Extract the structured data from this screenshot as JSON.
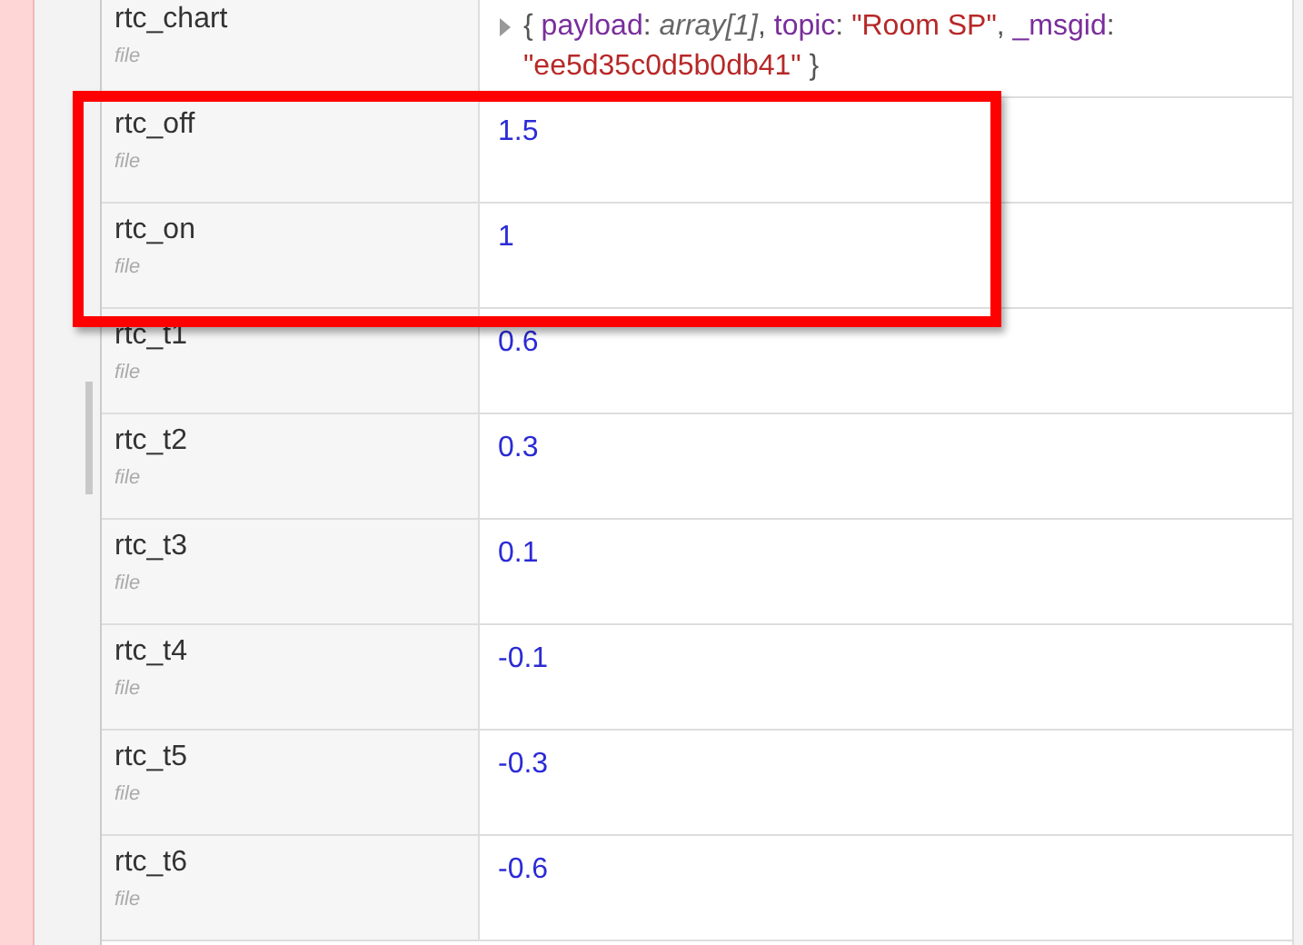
{
  "rows": [
    {
      "name": "rtc_chart",
      "scope": "file",
      "highlighted": false,
      "value": {
        "kind": "object",
        "parts": [
          {
            "kind": "punct",
            "text": "{ "
          },
          {
            "kind": "key",
            "text": "payload"
          },
          {
            "kind": "punct",
            "text": ": "
          },
          {
            "kind": "type",
            "text": "array[1]"
          },
          {
            "kind": "punct",
            "text": ", "
          },
          {
            "kind": "key",
            "text": "topic"
          },
          {
            "kind": "punct",
            "text": ": "
          },
          {
            "kind": "string",
            "text": "\"Room SP\""
          },
          {
            "kind": "punct",
            "text": ", "
          },
          {
            "kind": "key",
            "text": "_msgid"
          },
          {
            "kind": "punct",
            "text": ": "
          },
          {
            "kind": "string",
            "text": "\"ee5d35c0d5b0db41\""
          },
          {
            "kind": "punct",
            "text": " }"
          }
        ]
      }
    },
    {
      "name": "rtc_off",
      "scope": "file",
      "highlighted": true,
      "value": {
        "kind": "number",
        "text": "1.5"
      }
    },
    {
      "name": "rtc_on",
      "scope": "file",
      "highlighted": true,
      "value": {
        "kind": "number",
        "text": "1"
      }
    },
    {
      "name": "rtc_t1",
      "scope": "file",
      "highlighted": false,
      "value": {
        "kind": "number",
        "text": "0.6"
      }
    },
    {
      "name": "rtc_t2",
      "scope": "file",
      "highlighted": false,
      "value": {
        "kind": "number",
        "text": "0.3"
      }
    },
    {
      "name": "rtc_t3",
      "scope": "file",
      "highlighted": false,
      "value": {
        "kind": "number",
        "text": "0.1"
      }
    },
    {
      "name": "rtc_t4",
      "scope": "file",
      "highlighted": false,
      "value": {
        "kind": "number",
        "text": "-0.1"
      }
    },
    {
      "name": "rtc_t5",
      "scope": "file",
      "highlighted": false,
      "value": {
        "kind": "number",
        "text": "-0.3"
      }
    },
    {
      "name": "rtc_t6",
      "scope": "file",
      "highlighted": false,
      "value": {
        "kind": "number",
        "text": "-0.6"
      }
    }
  ]
}
